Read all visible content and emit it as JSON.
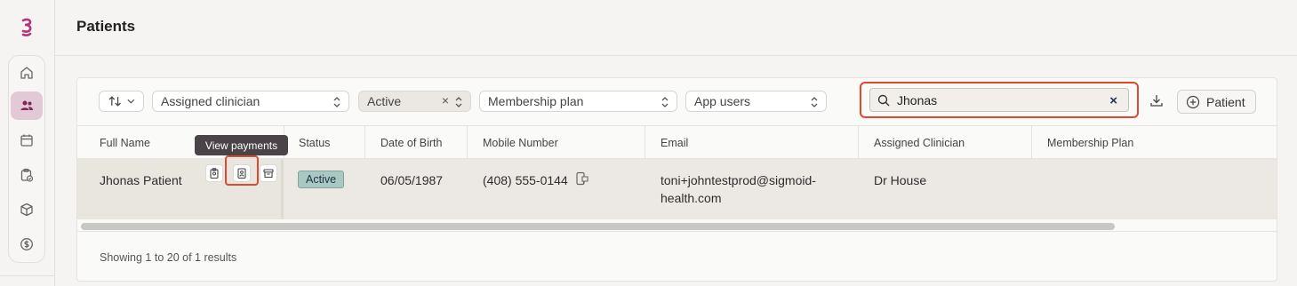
{
  "page": {
    "title": "Patients"
  },
  "sidebar": {
    "items": [
      {
        "name": "home-icon"
      },
      {
        "name": "patients-icon",
        "active": true
      },
      {
        "name": "calendar-icon"
      },
      {
        "name": "clipboard-check-icon"
      },
      {
        "name": "package-icon"
      },
      {
        "name": "dollar-icon"
      }
    ]
  },
  "toolbar": {
    "sort_icon": "sort-icon",
    "filters": [
      {
        "label": "Assigned clinician"
      },
      {
        "label": "Active",
        "clearable": true
      },
      {
        "label": "Membership plan"
      },
      {
        "label": "App users"
      }
    ],
    "search": {
      "value": "Jhonas",
      "clear_icon": "×"
    },
    "add_patient_label": "Patient"
  },
  "table": {
    "headers": [
      "Full Name",
      "Status",
      "Date of Birth",
      "Mobile Number",
      "Email",
      "Assigned Clinician",
      "Membership Plan"
    ],
    "rows": [
      {
        "full_name": "Jhonas Patient",
        "status": "Active",
        "dob": "06/05/1987",
        "mobile": "(408) 555-0144",
        "email_line1": "toni+johntestprod@sigmoid-",
        "email_line2": "health.com",
        "clinician": "Dr House",
        "membership": ""
      }
    ],
    "tooltip": "View payments"
  },
  "footer": {
    "summary": "Showing 1 to 20 of 1 results"
  },
  "colors": {
    "accent": "#e04a2c",
    "brand": "#b1367c",
    "nav_active": "#e3c9d6",
    "status_badge": "#a9c8c2"
  }
}
